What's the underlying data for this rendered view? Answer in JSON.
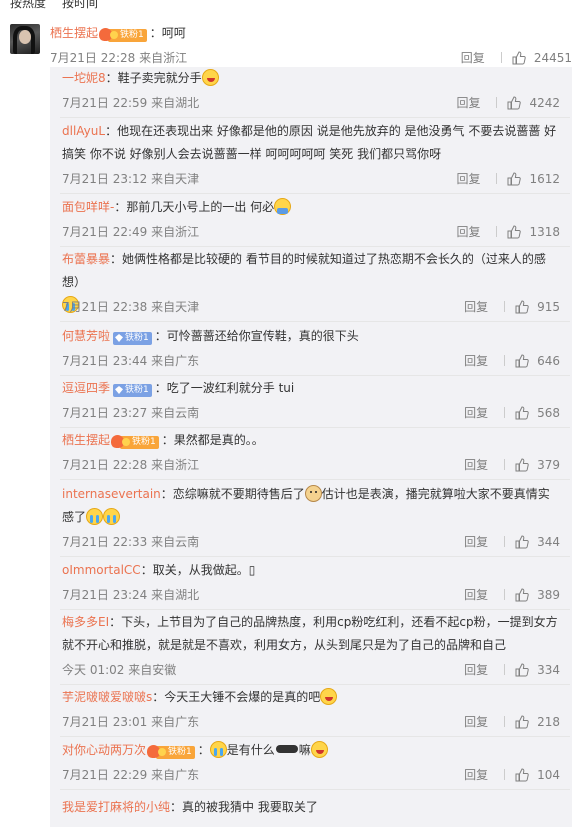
{
  "tabs": [
    "按热度",
    "按时间"
  ],
  "main_comment": {
    "user": "栖生摆起",
    "badge": "铁粉1",
    "text": "呵呵",
    "time": "7月21日 22:28",
    "source": "来自浙江",
    "reply_label": "回复",
    "likes": "24451"
  },
  "replies": [
    {
      "user": "一坨妮8",
      "badge": "",
      "text": "鞋子卖完就分手",
      "time": "7月21日 22:59",
      "source": "来自湖北",
      "likes": "4242"
    },
    {
      "user": "dllAyuL",
      "badge": "",
      "text": "他现在还表现出来 好像都是他的原因 说是他先放弃的 是他没勇气 不要去说蔷蔷 好搞笑 你不说 好像别人会去说蔷蔷一样 呵呵呵呵呵 笑死 我们都只骂你呀",
      "time": "7月21日 23:12",
      "source": "来自天津",
      "likes": "1612"
    },
    {
      "user": "面包咩咩-",
      "badge": "",
      "text": "那前几天小号上的一出 何必",
      "time": "7月21日 22:49",
      "source": "来自浙江",
      "likes": "1318"
    },
    {
      "user": "布蕾暴暴",
      "badge": "",
      "text": "她俩性格都是比较硬的 看节目的时候就知道过了热恋期不会长久的（过来人的感想）",
      "time": "7月21日 22:38",
      "source": "来自天津",
      "likes": "915"
    },
    {
      "user": "何慧芳啦",
      "badge": "铁粉1",
      "text": "可怜蔷蔷还给你宣传鞋，真的很下头",
      "time": "7月21日 23:44",
      "source": "来自广东",
      "likes": "646"
    },
    {
      "user": "逗逗四季",
      "badge": "铁粉1",
      "text": "吃了一波红利就分手 tui",
      "time": "7月21日 23:27",
      "source": "来自云南",
      "likes": "568"
    },
    {
      "user": "栖生摆起",
      "badge": "铁粉1",
      "text": "果然都是真的。。",
      "time": "7月21日 22:28",
      "source": "来自浙江",
      "likes": "379"
    },
    {
      "user": "internasevertain",
      "badge": "",
      "text": "恋综嘛就不要期待售后了",
      "text2": "估计也是表演，播完就算啦大家不要真情实感了",
      "time": "7月21日 22:33",
      "source": "来自云南",
      "likes": "344"
    },
    {
      "user": "oImmortalCC",
      "badge": "",
      "text": "取关，从我做起。▯",
      "time": "7月21日 23:24",
      "source": "来自湖北",
      "likes": "389"
    },
    {
      "user": "梅多多EI",
      "badge": "",
      "text": "下头，上节目为了自己的品牌热度，利用cp粉吃红利，还看不起cp粉，一提到女方就不开心和推脱，就是就是不喜欢，利用女方，从头到尾只是为了自己的品牌和自己",
      "time": "今天 01:02",
      "source": "来自安徽",
      "likes": "334"
    },
    {
      "user": "芋泥啵啵爱啵啵s",
      "badge": "",
      "text": "今天王大锤不会爆的是真的吧",
      "time": "7月21日 23:01",
      "source": "来自广东",
      "likes": "218"
    },
    {
      "user": "对你心动两万次",
      "badge": "铁粉1",
      "text": "是有什么",
      "text2": "嘛",
      "time": "7月21日 22:29",
      "source": "来自广东",
      "likes": "104"
    },
    {
      "user": "我是爱打麻将的小纯",
      "badge": "",
      "text": "真的被我猜中 我要取关了",
      "time": "",
      "source": "",
      "likes": ""
    }
  ],
  "colors": {
    "username": "#eb7350",
    "meta": "#808080",
    "sub_bg": "#f2f2f5"
  }
}
